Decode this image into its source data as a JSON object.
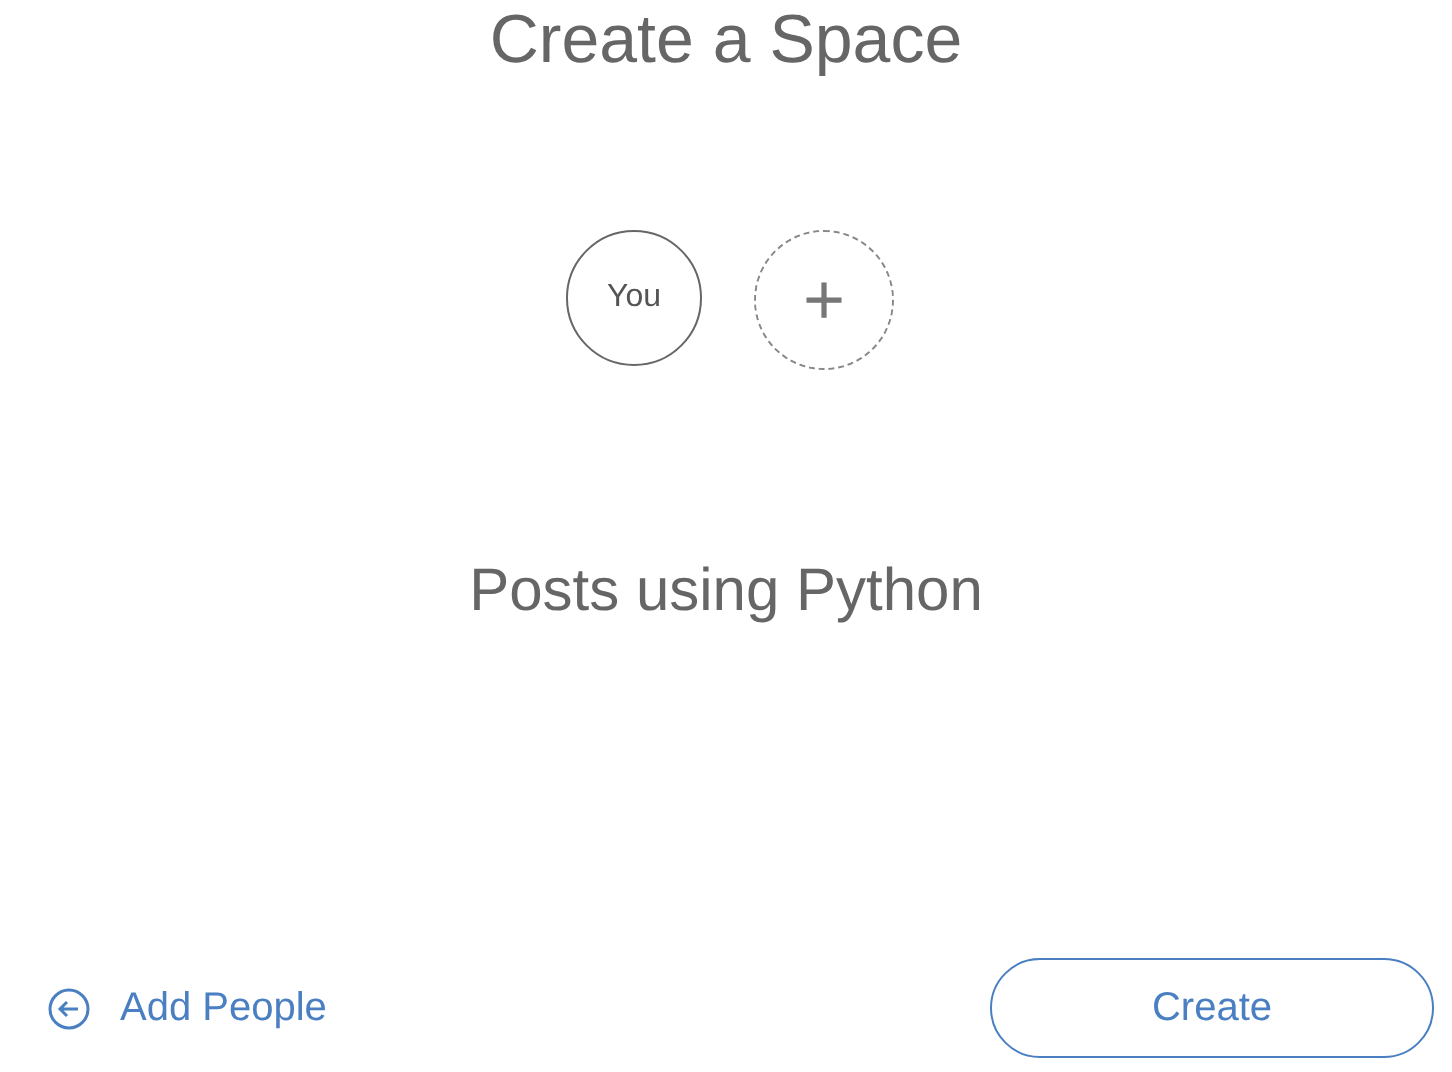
{
  "title": "Create a Space",
  "members": [
    {
      "kind": "person",
      "label": "You"
    },
    {
      "kind": "add",
      "label": "+"
    }
  ],
  "space_name": "Posts using Python",
  "back_link": {
    "label": "Add People"
  },
  "create_button": {
    "label": "Create"
  }
}
